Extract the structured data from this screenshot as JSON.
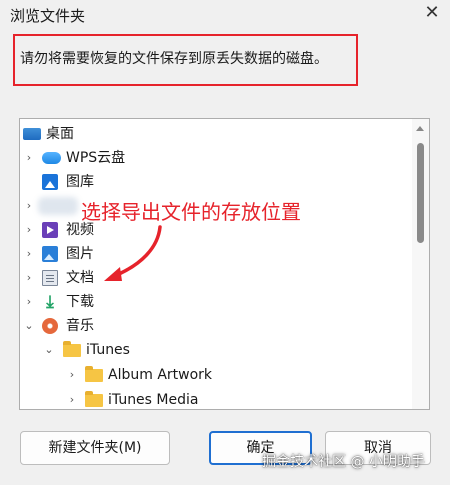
{
  "dialog": {
    "title": "浏览文件夹",
    "close_glyph": "✕"
  },
  "instruction": "请勿将需要恢复的文件保存到原丢失数据的磁盘。",
  "tree": {
    "items": [
      {
        "label": "桌面",
        "icon": "desktop-icon"
      },
      {
        "label": "WPS云盘",
        "icon": "cloud-icon",
        "expander": "›"
      },
      {
        "label": "图库",
        "icon": "gallery-icon"
      },
      {
        "label": "",
        "icon": "blurred-icon",
        "expander": "›"
      },
      {
        "label": "视频",
        "icon": "video-icon",
        "expander": "›"
      },
      {
        "label": "图片",
        "icon": "pictures-icon",
        "expander": "›"
      },
      {
        "label": "文档",
        "icon": "documents-icon",
        "expander": "›"
      },
      {
        "label": "下载",
        "icon": "download-icon",
        "expander": "›"
      },
      {
        "label": "音乐",
        "icon": "music-icon",
        "expander": "⌄"
      },
      {
        "label": "iTunes",
        "icon": "folder-icon",
        "expander": "⌄"
      },
      {
        "label": "Album Artwork",
        "icon": "folder-icon",
        "expander": "›"
      },
      {
        "label": "iTunes Media",
        "icon": "folder-icon",
        "expander": "›"
      }
    ]
  },
  "annotation": "选择导出文件的存放位置",
  "buttons": {
    "new_folder": "新建文件夹(M)",
    "ok": "确定",
    "cancel": "取消"
  },
  "watermark": "掘金技术社区 @ 小明助手",
  "colors": {
    "annotation_red": "#e6232b",
    "default_button_border": "#1f6fd1"
  }
}
